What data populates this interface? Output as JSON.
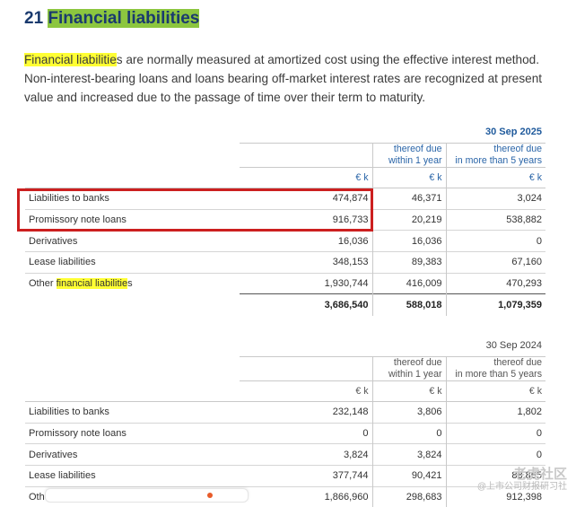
{
  "section": {
    "number": "21",
    "title": "Financial liabilities"
  },
  "intro": {
    "highlight": "Financial liabilitie",
    "rest": "s are normally measured at amortized cost using the effective interest method. Non-interest-bearing loans and loans bearing off-market interest rates are recognized at present value and increased due to the passage of time over their term to maturity."
  },
  "table_2025": {
    "date": "30 Sep 2025",
    "col_headers": [
      "",
      "thereof due\nwithin 1 year",
      "thereof due\nin more than 5 years"
    ],
    "unit": "€ k",
    "rows": [
      {
        "label": "Liabilities to banks",
        "total": "474,874",
        "within1": "46,371",
        "over5": "3,024"
      },
      {
        "label": "Promissory note loans",
        "total": "916,733",
        "within1": "20,219",
        "over5": "538,882"
      },
      {
        "label": "Derivatives",
        "total": "16,036",
        "within1": "16,036",
        "over5": "0"
      },
      {
        "label": "Lease liabilities",
        "total": "348,153",
        "within1": "89,383",
        "over5": "67,160"
      },
      {
        "label_prefix": "Other ",
        "label_highlight": "financial liabilitie",
        "label_suffix": "s",
        "total": "1,930,744",
        "within1": "416,009",
        "over5": "470,293"
      }
    ],
    "totals": {
      "total": "3,686,540",
      "within1": "588,018",
      "over5": "1,079,359"
    }
  },
  "table_2024": {
    "date": "30 Sep 2024",
    "col_headers": [
      "",
      "thereof due\nwithin 1 year",
      "thereof due\nin more than 5 years"
    ],
    "unit": "€ k",
    "rows": [
      {
        "label": "Liabilities to banks",
        "total": "232,148",
        "within1": "3,806",
        "over5": "1,802"
      },
      {
        "label": "Promissory note loans",
        "total": "0",
        "within1": "0",
        "over5": "0"
      },
      {
        "label": "Derivatives",
        "total": "3,824",
        "within1": "3,824",
        "over5": "0"
      },
      {
        "label": "Lease liabilities",
        "total": "377,744",
        "within1": "90,421",
        "over5": "88,865"
      },
      {
        "label": "Other financial liabilities",
        "total": "1,866,960",
        "within1": "298,683",
        "over5": "912,398"
      }
    ]
  },
  "watermark": {
    "line1": "老虎社区",
    "line2": "@上市公司财报研习社"
  },
  "colors": {
    "heading": "#1a3a6e",
    "heading_highlight": "#8cc63f",
    "text_highlight": "#ffff33",
    "annotation_box": "#cc1f1f",
    "accent_blue": "#2a65a8"
  }
}
